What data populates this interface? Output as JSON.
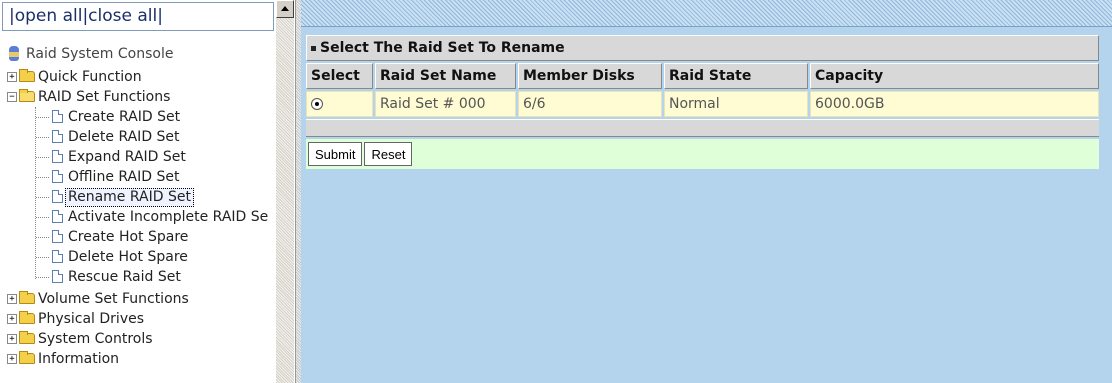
{
  "toplinks": {
    "prefix": "|",
    "open_all": "open all",
    "sep": "|",
    "close_all": "close all",
    "suffix": "|"
  },
  "tree": {
    "root": "Raid System Console",
    "items": [
      {
        "label": "Quick Function",
        "type": "folder",
        "expanded": false
      },
      {
        "label": "RAID Set Functions",
        "type": "folder",
        "expanded": true,
        "children": [
          "Create RAID Set",
          "Delete RAID Set",
          "Expand RAID Set",
          "Offline RAID Set",
          "Rename RAID Set",
          "Activate Incomplete RAID Se",
          "Create Hot Spare",
          "Delete Hot Spare",
          "Rescue Raid Set"
        ],
        "selected_child": "Rename RAID Set"
      },
      {
        "label": "Volume Set Functions",
        "type": "folder",
        "expanded": false
      },
      {
        "label": "Physical Drives",
        "type": "folder",
        "expanded": false
      },
      {
        "label": "System Controls",
        "type": "folder",
        "expanded": false
      },
      {
        "label": "Information",
        "type": "folder",
        "expanded": false
      }
    ]
  },
  "panel": {
    "title": "Select The Raid Set To Rename",
    "columns": [
      "Select",
      "Raid Set Name",
      "Member Disks",
      "Raid State",
      "Capacity"
    ],
    "rows": [
      {
        "selected": true,
        "name": "Raid Set # 000",
        "member_disks": "6/6",
        "state": "Normal",
        "capacity": "6000.0GB"
      }
    ],
    "submit_label": "Submit",
    "reset_label": "Reset"
  },
  "colors": {
    "main_bg": "#b4d4ee",
    "row_bg": "#fffbd2",
    "action_bg": "#dfffd8",
    "header_bg": "#d8d8d8"
  }
}
